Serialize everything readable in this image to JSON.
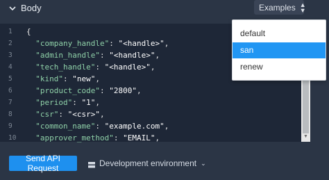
{
  "header": {
    "title": "Body",
    "collapse_icon": "chevron-down-icon"
  },
  "examples": {
    "label": "Examples",
    "icon": "sort-icon"
  },
  "dropdown": {
    "items": [
      "default",
      "san",
      "renew"
    ],
    "selected": "san"
  },
  "code": {
    "line_numbers": [
      "1",
      "2",
      "3",
      "4",
      "5",
      "6",
      "7",
      "8",
      "9",
      "10"
    ],
    "lines": [
      {
        "pre": "{",
        "key": "",
        "mid": "",
        "val": "",
        "post": ""
      },
      {
        "pre": "  ",
        "key": "\"company_handle\"",
        "mid": ": ",
        "val": "\"<handle>\"",
        "post": ","
      },
      {
        "pre": "  ",
        "key": "\"admin_handle\"",
        "mid": ": ",
        "val": "\"<handle>\"",
        "post": ","
      },
      {
        "pre": "  ",
        "key": "\"tech_handle\"",
        "mid": ": ",
        "val": "\"<handle>\"",
        "post": ","
      },
      {
        "pre": "  ",
        "key": "\"kind\"",
        "mid": ": ",
        "val": "\"new\"",
        "post": ","
      },
      {
        "pre": "  ",
        "key": "\"product_code\"",
        "mid": ": ",
        "val": "\"2800\"",
        "post": ","
      },
      {
        "pre": "  ",
        "key": "\"period\"",
        "mid": ": ",
        "val": "\"1\"",
        "post": ","
      },
      {
        "pre": "  ",
        "key": "\"csr\"",
        "mid": ": ",
        "val": "\"<csr>\"",
        "post": ","
      },
      {
        "pre": "  ",
        "key": "\"common_name\"",
        "mid": ": ",
        "val": "\"example.com\"",
        "post": ","
      },
      {
        "pre": "  ",
        "key": "\"approver_method\"",
        "mid": ": ",
        "val": "\"EMAIL\"",
        "post": ","
      }
    ]
  },
  "footer": {
    "send_label": "Send API Request",
    "environment_label": "Development environment",
    "environment_icon": "server-icon"
  },
  "colors": {
    "panel": "#2b3545",
    "editor": "#1e2737",
    "accent": "#1e90ef",
    "selected": "#2196f3",
    "json_key": "#8fd1a8"
  }
}
